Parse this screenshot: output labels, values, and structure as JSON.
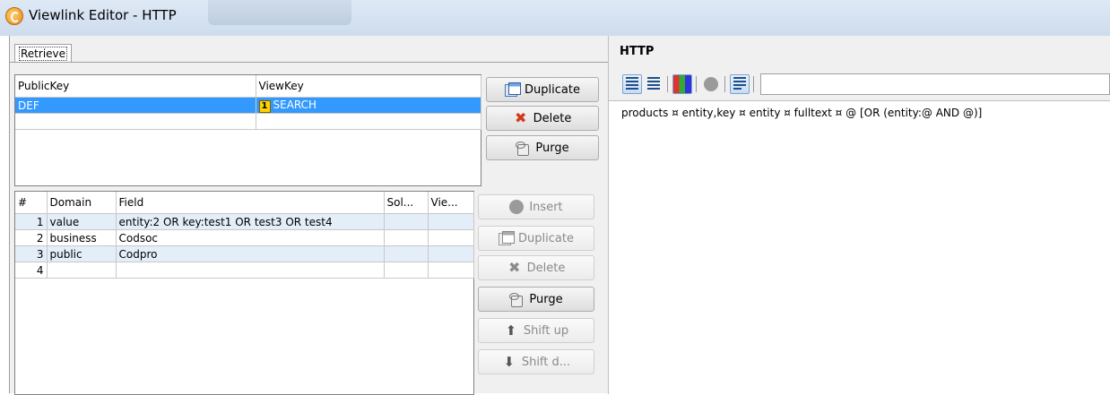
{
  "window": {
    "title": "Viewlink Editor - HTTP"
  },
  "tabs": [
    {
      "label": "Retrieve"
    }
  ],
  "keys_table": {
    "headers": [
      "PublicKey",
      "ViewKey"
    ],
    "rows": [
      {
        "public_key": "DEF",
        "badge": "1",
        "view_key": "SEARCH",
        "selected": true
      },
      {
        "public_key": "",
        "view_key": ""
      }
    ]
  },
  "keys_buttons": {
    "duplicate": "Duplicate",
    "delete": "Delete",
    "purge": "Purge"
  },
  "fields_table": {
    "headers": [
      "#",
      "Domain",
      "Field",
      "Sol...",
      "Vie..."
    ],
    "rows": [
      {
        "num": "1",
        "domain": "value",
        "field": "entity:2 OR key:test1 OR test3 OR test4",
        "sol": "",
        "vie": ""
      },
      {
        "num": "2",
        "domain": "business",
        "field": "Codsoc",
        "sol": "",
        "vie": ""
      },
      {
        "num": "3",
        "domain": "public",
        "field": "Codpro",
        "sol": "",
        "vie": ""
      },
      {
        "num": "4",
        "domain": "",
        "field": "",
        "sol": "",
        "vie": ""
      }
    ]
  },
  "fields_buttons": {
    "insert": "Insert",
    "duplicate": "Duplicate",
    "delete": "Delete",
    "purge": "Purge",
    "shift_up": "Shift up",
    "shift_down": "Shift d..."
  },
  "right_panel": {
    "title": "HTTP",
    "query_text": "products ¤ entity,key ¤ entity ¤ fulltext ¤ @ [OR (entity:@ AND @)]",
    "search_value": ""
  }
}
